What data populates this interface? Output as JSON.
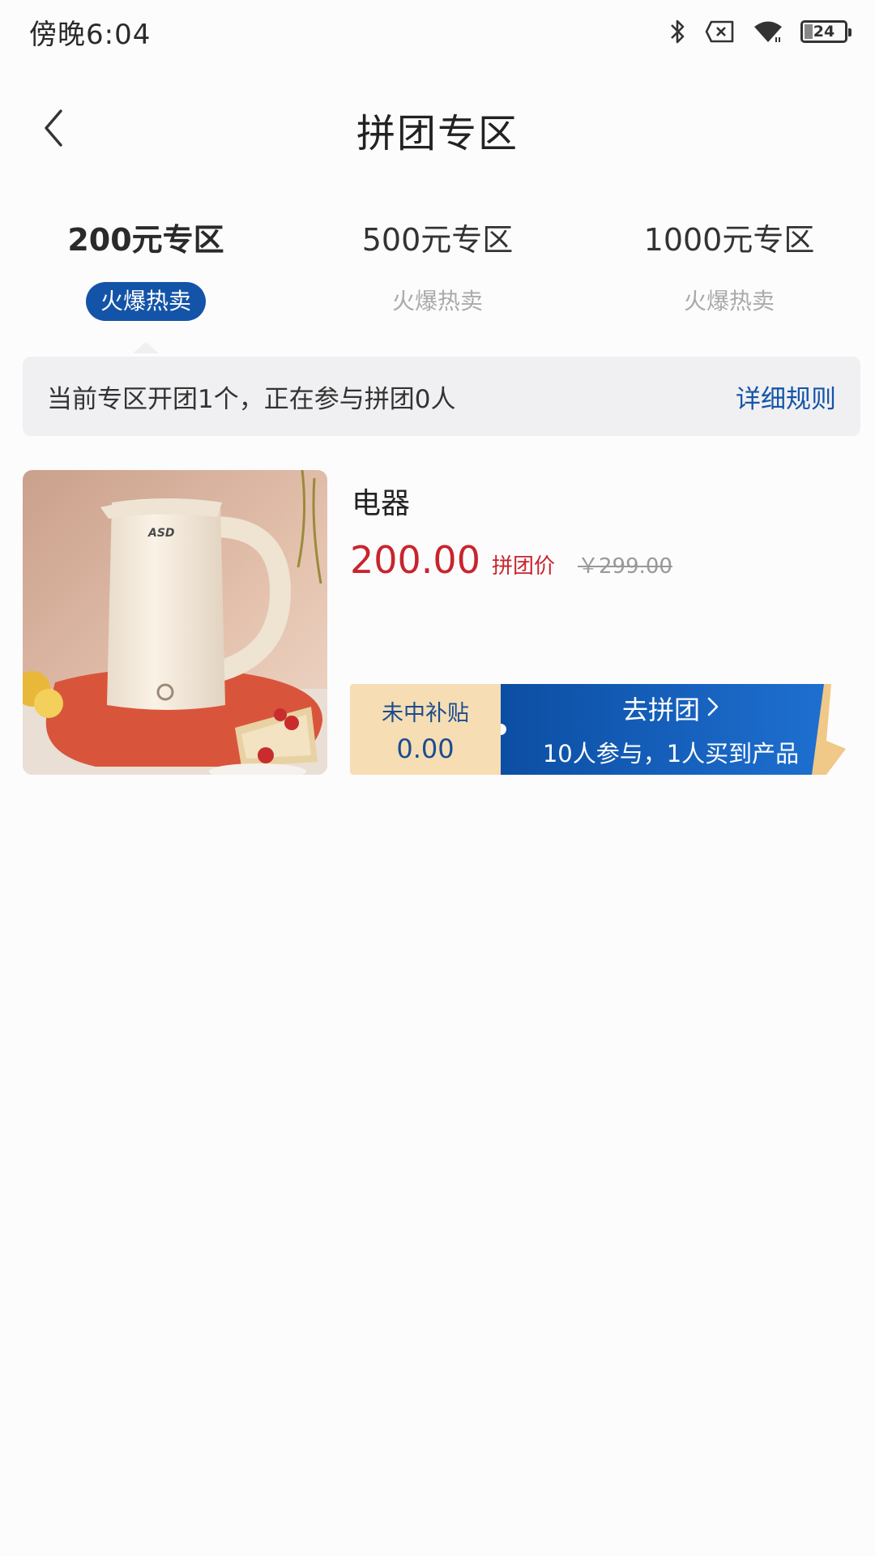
{
  "status_bar": {
    "time": "傍晚6:04",
    "battery_level": "24",
    "icons": [
      "bluetooth-icon",
      "sim-off-icon",
      "wifi-icon",
      "battery-icon"
    ]
  },
  "nav": {
    "title": "拼团专区",
    "back_icon": "chevron-left-icon"
  },
  "tabs": [
    {
      "label": "200元专区",
      "sub": "火爆热卖",
      "active": true
    },
    {
      "label": "500元专区",
      "sub": "火爆热卖",
      "active": false
    },
    {
      "label": "1000元专区",
      "sub": "火爆热卖",
      "active": false
    }
  ],
  "info": {
    "text": "当前专区开团1个，正在参与拼团0人",
    "rules_link": "详细规则"
  },
  "products": [
    {
      "name": "电器",
      "price": "200.00",
      "price_tag": "拼团价",
      "original_price": "￥299.00",
      "subsidy_label": "未中补贴",
      "subsidy_value": "0.00",
      "join_label": "去拼团",
      "join_sub": "10人参与，1人买到产品",
      "brand_mark": "ASD"
    }
  ],
  "colors": {
    "accent_blue": "#1454a8",
    "price_red": "#c8242e",
    "subsidy_bg": "#f6ddb4",
    "info_bg": "#f0f0f2"
  }
}
